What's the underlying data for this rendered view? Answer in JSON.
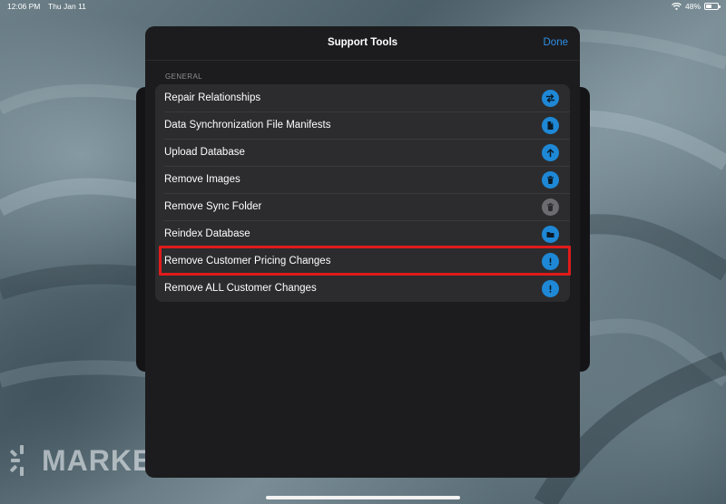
{
  "status_bar": {
    "time": "12:06 PM",
    "date": "Thu Jan 11",
    "battery": "48%",
    "battery_level": 0.48
  },
  "background": {
    "logo_text": "MARKET"
  },
  "modal": {
    "title": "Support Tools",
    "done_label": "Done",
    "section_label": "GENERAL",
    "items": [
      {
        "label": "Repair Relationships",
        "icon": "arrows-swap-icon",
        "icon_color": "#1e88d6"
      },
      {
        "label": "Data Synchronization File Manifests",
        "icon": "document-icon",
        "icon_color": "#1e88d6"
      },
      {
        "label": "Upload Database",
        "icon": "arrow-up-icon",
        "icon_color": "#1e88d6"
      },
      {
        "label": "Remove Images",
        "icon": "trash-icon",
        "icon_color": "#1e88d6"
      },
      {
        "label": "Remove Sync Folder",
        "icon": "trash-icon",
        "icon_color": "#6b6b70"
      },
      {
        "label": "Reindex Database",
        "icon": "folder-icon",
        "icon_color": "#1e88d6"
      },
      {
        "label": "Remove Customer Pricing Changes",
        "icon": "exclamation-icon",
        "icon_color": "#1e88d6"
      },
      {
        "label": "Remove ALL Customer Changes",
        "icon": "exclamation-icon",
        "icon_color": "#1e88d6"
      }
    ]
  },
  "annotation": {
    "highlight_color": "#e01b1b",
    "highlighted_item": "Remove Customer Pricing Changes"
  },
  "colors": {
    "accent": "#2e8ee6",
    "modal_bg": "#1c1c1e",
    "row_bg": "#2c2c2e"
  }
}
